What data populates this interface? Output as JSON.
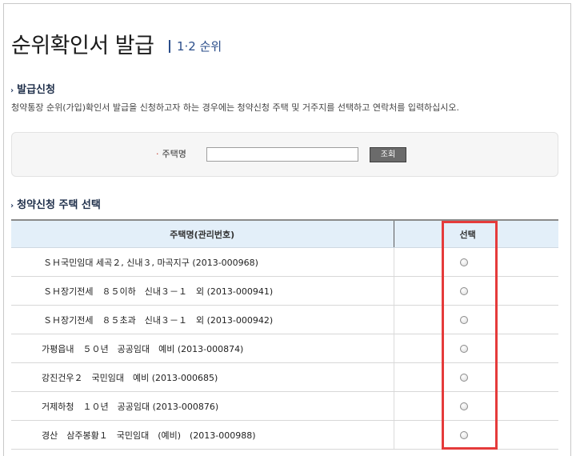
{
  "header": {
    "title": "순위확인서 발급",
    "subtitle": "1·2 순위"
  },
  "apply_section": {
    "heading": "발급신청",
    "description": "청약통장 순위(가입)확인서 발급을 신청하고자 하는 경우에는 청약신청 주택 및 거주지를 선택하고 연락처를 입력하십시오."
  },
  "search": {
    "label": "주택명",
    "input_value": "",
    "button_label": "조회"
  },
  "select_section": {
    "heading": "청약신청 주택 선택"
  },
  "table": {
    "headers": [
      "주택명(관리번호)",
      "선택"
    ],
    "rows": [
      {
        "name": "ＳＨ국민임대 세곡２, 신내３, 마곡지구 (2013-000968)",
        "selected": false
      },
      {
        "name": "ＳＨ장기전세　８５이하　신내３－１　외 (2013-000941)",
        "selected": false
      },
      {
        "name": "ＳＨ장기전세　８５초과　신내３－１　외 (2013-000942)",
        "selected": false
      },
      {
        "name": "가평읍내　５０년　공공임대　예비 (2013-000874)",
        "selected": false
      },
      {
        "name": "강진건우２　국민임대　예비 (2013-000685)",
        "selected": false
      },
      {
        "name": "거제하청　１０년　공공임대 (2013-000876)",
        "selected": false
      },
      {
        "name": "경산　삼주봉황１　국민임대　(예비)　(2013-000988)",
        "selected": false
      }
    ]
  },
  "colors": {
    "table_header_bg": "#e3eff9",
    "highlight_box": "#e53b3b",
    "title_accent": "#2a4d8a"
  }
}
